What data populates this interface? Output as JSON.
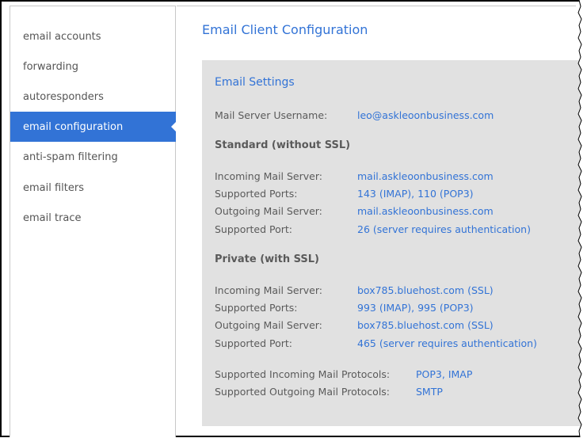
{
  "sidebar": {
    "items": [
      {
        "label": "email accounts",
        "active": false
      },
      {
        "label": "forwarding",
        "active": false
      },
      {
        "label": "autoresponders",
        "active": false
      },
      {
        "label": "email configuration",
        "active": true
      },
      {
        "label": "anti-spam filtering",
        "active": false
      },
      {
        "label": "email filters",
        "active": false
      },
      {
        "label": "email trace",
        "active": false
      }
    ]
  },
  "main": {
    "title": "Email Client Configuration",
    "panel": {
      "title": "Email Settings",
      "username_label": "Mail Server Username:",
      "username_value": "leo@askleoonbusiness.com",
      "standard": {
        "heading": "Standard (without SSL)",
        "rows": [
          {
            "label": "Incoming Mail Server:",
            "value": "mail.askleoonbusiness.com"
          },
          {
            "label": "Supported Ports:",
            "value": "143 (IMAP), 110 (POP3)"
          },
          {
            "label": "Outgoing Mail Server:",
            "value": "mail.askleoonbusiness.com"
          },
          {
            "label": "Supported Port:",
            "value": "26 (server requires authentication)"
          }
        ]
      },
      "private": {
        "heading": "Private (with SSL)",
        "rows": [
          {
            "label": "Incoming Mail Server:",
            "value": "box785.bluehost.com (SSL)"
          },
          {
            "label": "Supported Ports:",
            "value": "993 (IMAP), 995 (POP3)"
          },
          {
            "label": "Outgoing Mail Server:",
            "value": "box785.bluehost.com (SSL)"
          },
          {
            "label": "Supported Port:",
            "value": "465 (server requires authentication)"
          }
        ]
      },
      "protocols": [
        {
          "label": "Supported Incoming Mail Protocols:",
          "value": "POP3, IMAP"
        },
        {
          "label": "Supported Outgoing Mail Protocols:",
          "value": "SMTP"
        }
      ]
    }
  },
  "colors": {
    "accent": "#3273d6",
    "panel_bg": "#e1e1e1",
    "label_text": "#5a5a5a"
  }
}
